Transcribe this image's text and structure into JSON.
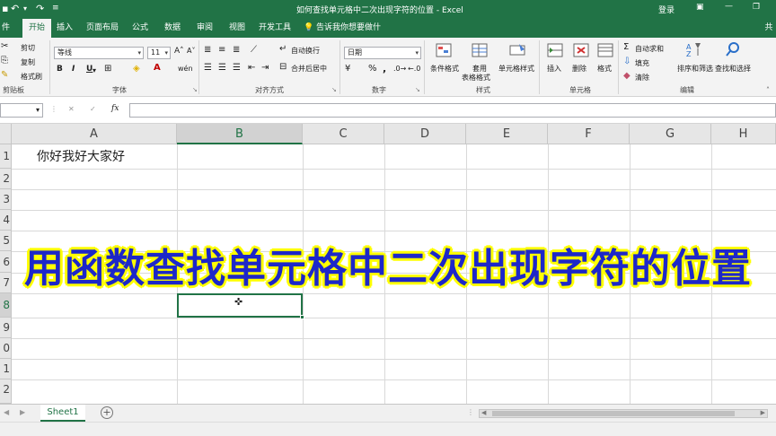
{
  "titlebar": {
    "title": "如何查找单元格中二次出现字符的位置 - Excel",
    "login": "登录"
  },
  "tabs": [
    "开始",
    "插入",
    "页面布局",
    "公式",
    "数据",
    "审阅",
    "视图",
    "开发工具"
  ],
  "tell_me": "告诉我你想要做什么",
  "share": "共",
  "ribbon": {
    "clipboard": {
      "cut": "剪切",
      "copy": "复制",
      "painter": "格式刷",
      "group": "剪贴板"
    },
    "font": {
      "name": "等线",
      "size": "11",
      "group": "字体",
      "bold": "B",
      "italic": "I",
      "underline": "U"
    },
    "align": {
      "wrap": "自动换行",
      "merge": "合并后居中",
      "group": "对齐方式"
    },
    "number": {
      "format": "日期",
      "percent": "%",
      "comma": ",",
      "group": "数字"
    },
    "styles": {
      "cond": "条件格式",
      "table_line1": "套用",
      "table_line2": "表格格式",
      "cell": "单元格样式",
      "group": "样式"
    },
    "cells": {
      "insert": "插入",
      "delete": "删除",
      "format": "格式",
      "group": "单元格"
    },
    "editing": {
      "autosum": "自动求和",
      "fill": "填充",
      "clear": "清除",
      "sort": "排序和筛选",
      "find": "查找和选择",
      "group": "编辑"
    }
  },
  "formula_bar": {
    "fx": "fx",
    "cancel": "✕",
    "enter": "✓"
  },
  "columns": [
    "A",
    "B",
    "C",
    "D",
    "E",
    "F",
    "G",
    "H"
  ],
  "rows": [
    "1",
    "2",
    "3",
    "4",
    "5",
    "6",
    "7",
    "8",
    "9",
    "0",
    "1",
    "2"
  ],
  "cells": {
    "A1": "你好我好大家好"
  },
  "overlay_title": "用函数查找单元格中二次出现字符的位置",
  "sheets": [
    "Sheet1"
  ],
  "colors": {
    "accent": "#217346",
    "overlay_text": "#1d27c9",
    "overlay_outline": "#ffff00"
  }
}
